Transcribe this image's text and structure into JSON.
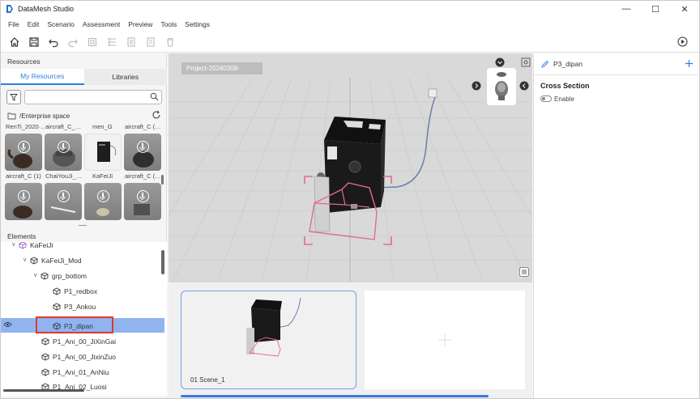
{
  "window": {
    "title": "DataMesh Studio",
    "controls": [
      "—",
      "☐",
      "✕"
    ]
  },
  "menu": [
    "File",
    "Edit",
    "Scenario",
    "Assessment",
    "Preview",
    "Tools",
    "Settings"
  ],
  "toolbar": {
    "icons": [
      "home-icon",
      "save-icon",
      "undo-icon",
      "redo-icon",
      "import-icon",
      "group-icon",
      "copy-icon",
      "paste-icon",
      "delete-icon"
    ],
    "play_icon": "play-icon"
  },
  "resources": {
    "title": "Resources",
    "tabs": [
      "My Resources",
      "Libraries"
    ],
    "search": {
      "value": "",
      "placeholder": ""
    },
    "path": "/Enterprise space",
    "row1_names": [
      "RenTi_2020·…",
      "aircraft_C_…",
      "men_G",
      "aircraft_C (…"
    ],
    "row2_names": [
      "aircraft_C (1)",
      "ChaiYouJi_…",
      "KaFeiJi",
      "aircraft_C (…"
    ]
  },
  "elements": {
    "title": "Elements",
    "nodes": [
      {
        "label": "KaFeiJi",
        "depth": 1,
        "expanded": true,
        "color": "#9b59d0"
      },
      {
        "label": "KaFeiJi_Mod",
        "depth": 2,
        "expanded": true
      },
      {
        "label": "grp_bottom",
        "depth": 3,
        "expanded": true
      },
      {
        "label": "P1_redbox",
        "depth": 4
      },
      {
        "label": "P3_Ankou",
        "depth": 4
      },
      {
        "label": "P3_dipan",
        "depth": 4,
        "selected": true
      },
      {
        "label": "P1_Ani_00_JiXinGai",
        "depth": 3
      },
      {
        "label": "P1_Ani_00_JixinZuo",
        "depth": 3
      },
      {
        "label": "P1_Ani_01_AnNiu",
        "depth": 3
      },
      {
        "label": "P1_Ani_02_Luosi",
        "depth": 3
      }
    ]
  },
  "viewport": {
    "project_label": "Project-20240308-"
  },
  "scenes": {
    "items": [
      {
        "label": "01  Scene_1"
      }
    ],
    "add_icon": "plus-icon"
  },
  "properties": {
    "title": "P3_dipan",
    "section": "Cross Section",
    "toggle_label": "Enable",
    "toggle_on": false
  },
  "colors": {
    "accent": "#2f7ee6",
    "selection": "#8fb4f0",
    "highlight_box": "#e4352b",
    "cross_section": "#e06a94"
  }
}
